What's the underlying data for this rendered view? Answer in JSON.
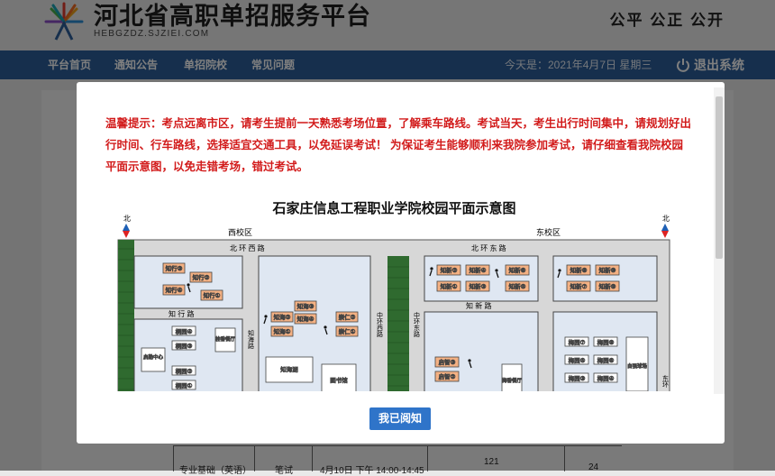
{
  "header": {
    "site_title": "河北省高职单招服务平台",
    "site_subtitle": "HEBGZDZ.SJZIEI.COM",
    "slogan": "公平 公正 公开"
  },
  "nav": {
    "items": [
      "平台首页",
      "通知公告",
      "单招院校",
      "常见问题"
    ],
    "date_text": "今天是：2021年4月7日 星期三",
    "logout_label": "退出系统"
  },
  "background_table": {
    "row": [
      "专业基础（英语）",
      "笔试",
      "4月10日 下午 14:00-14:45",
      "121",
      "24"
    ]
  },
  "modal": {
    "notice": "温馨提示：考点远离市区，请考生提前一天熟悉考场位置，了解乘车路线。考试当天，考生出行时间集中，请规划好出行时间、行车路线，选择适宜交通工具，以免延误考试！ 为保证考生能够顺利来我院参加考试，请仔细查看我院校园平面示意图，以免走错考场，错过考试。",
    "confirm_label": "我已阅知"
  },
  "campus_map": {
    "title": "石家庄信息工程职业学院校园平面示意图",
    "north_label": "北",
    "campus_west": "西校区",
    "campus_east": "东校区",
    "roads": {
      "north_west": "北 环 西 路",
      "north_east": "北 环 东 路",
      "zhixing": "知 行 路",
      "zhixin": "知 新 路",
      "zhihai": "知海路",
      "central_west": "中环西路",
      "central_east": "中环东路",
      "east": "东环"
    },
    "buildings": {
      "zhixing": [
        "知行③",
        "知行②",
        "知行④",
        "知行①"
      ],
      "zhihai": [
        "知海②",
        "知海③",
        "知海①",
        "知海④"
      ],
      "chongren": [
        "崇仁②",
        "崇仁①"
      ],
      "zhixin_a": [
        "知新②",
        "知新④",
        "知新①",
        "知新③"
      ],
      "zhixin_b": [
        "知新⑥",
        "知新⑤"
      ],
      "zhixin_c": [
        "知新⑧",
        "知新⑩",
        "知新⑦",
        "知新⑨"
      ],
      "tongyuan": [
        "桐园④",
        "桐园③",
        "桐园②",
        "桐园①"
      ],
      "meiyuan": [
        "梅园⑦",
        "梅园⑧",
        "梅园⑤",
        "梅园⑥",
        "梅园③",
        "梅园④"
      ],
      "qizhi": [
        "启智③",
        "启智②"
      ],
      "others": [
        "启勤中心",
        "桂香餐厅",
        "知海湖",
        "图书馆",
        "梅香餐厅",
        "自强球场"
      ]
    }
  }
}
